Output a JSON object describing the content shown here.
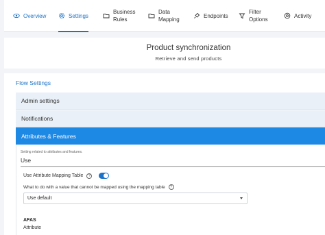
{
  "tabs": [
    {
      "label": "Overview",
      "icon": "eye-icon",
      "active": false
    },
    {
      "label": "Settings",
      "icon": "gear-icon",
      "active": true
    },
    {
      "label": "Business Rules",
      "icon": "folder-icon",
      "active": false
    },
    {
      "label": "Data Mapping",
      "icon": "folder-icon",
      "active": false
    },
    {
      "label": "Endpoints",
      "icon": "plug-icon",
      "active": false
    },
    {
      "label": "Filter Options",
      "icon": "filter-icon",
      "active": false
    },
    {
      "label": "Activity",
      "icon": "activity-icon",
      "active": false
    }
  ],
  "hero": {
    "title": "Product synchronization",
    "subtitle": "Retrieve and send products"
  },
  "flow_settings": {
    "title": "Flow Settings",
    "sections": [
      {
        "label": "Admin settings",
        "expanded": false
      },
      {
        "label": "Notifications",
        "expanded": false
      },
      {
        "label": "Attributes & Features",
        "expanded": true
      }
    ]
  },
  "attributes": {
    "hint": "Setting related to attributes and features.",
    "use_label": "Use",
    "mapping_table_label": "Use Attribute Mapping Table",
    "mapping_table_enabled": true,
    "unmapped_question": "What to do with a value that cannot be mapped using the mapping table",
    "unmapped_value": "Use default",
    "afas_label": "AFAS",
    "attribute_label": "Attribute"
  },
  "colors": {
    "accent": "#1a73c8",
    "active_section": "#1e88e5",
    "section_bg": "#e9f0f7",
    "page_bg": "#f2f4f7"
  }
}
